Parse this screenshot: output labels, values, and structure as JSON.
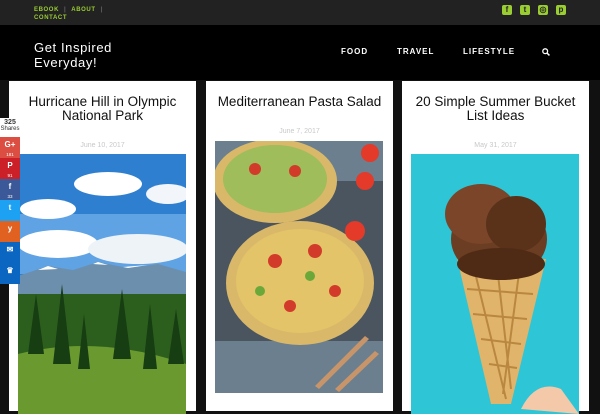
{
  "topbar": {
    "links": [
      "EBOOK",
      "ABOUT",
      "CONTACT"
    ]
  },
  "social": [
    "facebook-icon",
    "twitter-icon",
    "instagram-icon",
    "pinterest-icon"
  ],
  "header": {
    "logo_line1": "Get Inspired",
    "logo_line2": "Everyday!",
    "nav": [
      "FOOD",
      "TRAVEL",
      "LIFESTYLE"
    ]
  },
  "posts": [
    {
      "title": "Hurricane Hill in Olympic National Park",
      "date": "June 10, 2017"
    },
    {
      "title": "Mediterranean Pasta Salad",
      "date": "June 7, 2017"
    },
    {
      "title": "20 Simple Summer Bucket List Ideas",
      "date": "May 31, 2017"
    }
  ],
  "share": {
    "total": "325",
    "total_label": "Shares",
    "items": [
      {
        "icon": "google-plus-icon",
        "color": "#dc4e41",
        "count": "181"
      },
      {
        "icon": "pinterest-icon",
        "color": "#cb2027",
        "count": "91"
      },
      {
        "icon": "facebook-icon",
        "color": "#3b5998",
        "count": "33"
      },
      {
        "icon": "twitter-icon",
        "color": "#1da1f2",
        "count": ""
      },
      {
        "icon": "yummly-icon",
        "color": "#e16120",
        "count": ""
      },
      {
        "icon": "email-icon",
        "color": "#0b66c2",
        "count": ""
      },
      {
        "icon": "crown-icon",
        "color": "#0b66c2",
        "count": ""
      }
    ]
  },
  "colors": {
    "accent": "#9acd32"
  }
}
